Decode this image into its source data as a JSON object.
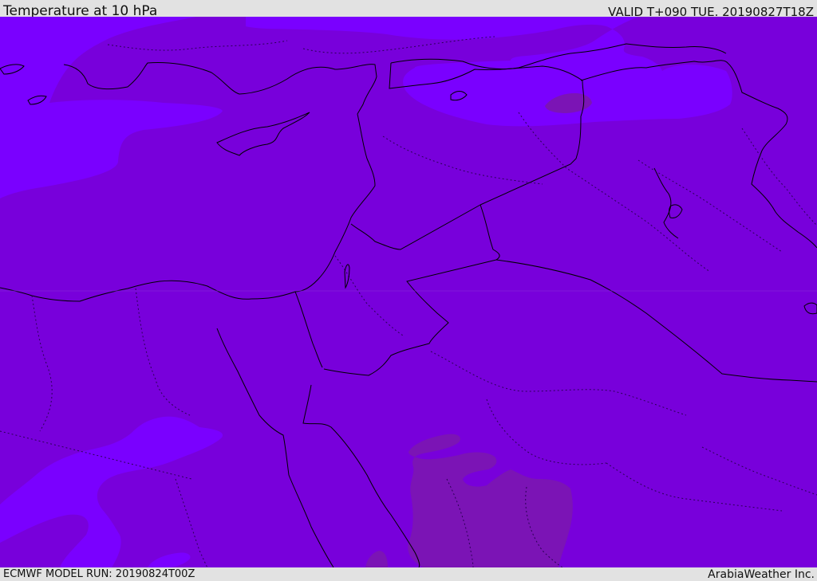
{
  "header": {
    "title": "Temperature at 10 hPa",
    "valid_time": "VALID T+090 TUE. 20190827T18Z"
  },
  "footer": {
    "model_run": "ECMWF MODEL RUN: 20190824T00Z",
    "credit": "ArabiaWeather Inc."
  },
  "map": {
    "colors": {
      "base_field": "#7800db",
      "warmer_field": "#7a00ff",
      "cooler_field": "#7b14b5",
      "coastline": "#000000",
      "border": "#2b0055"
    }
  }
}
